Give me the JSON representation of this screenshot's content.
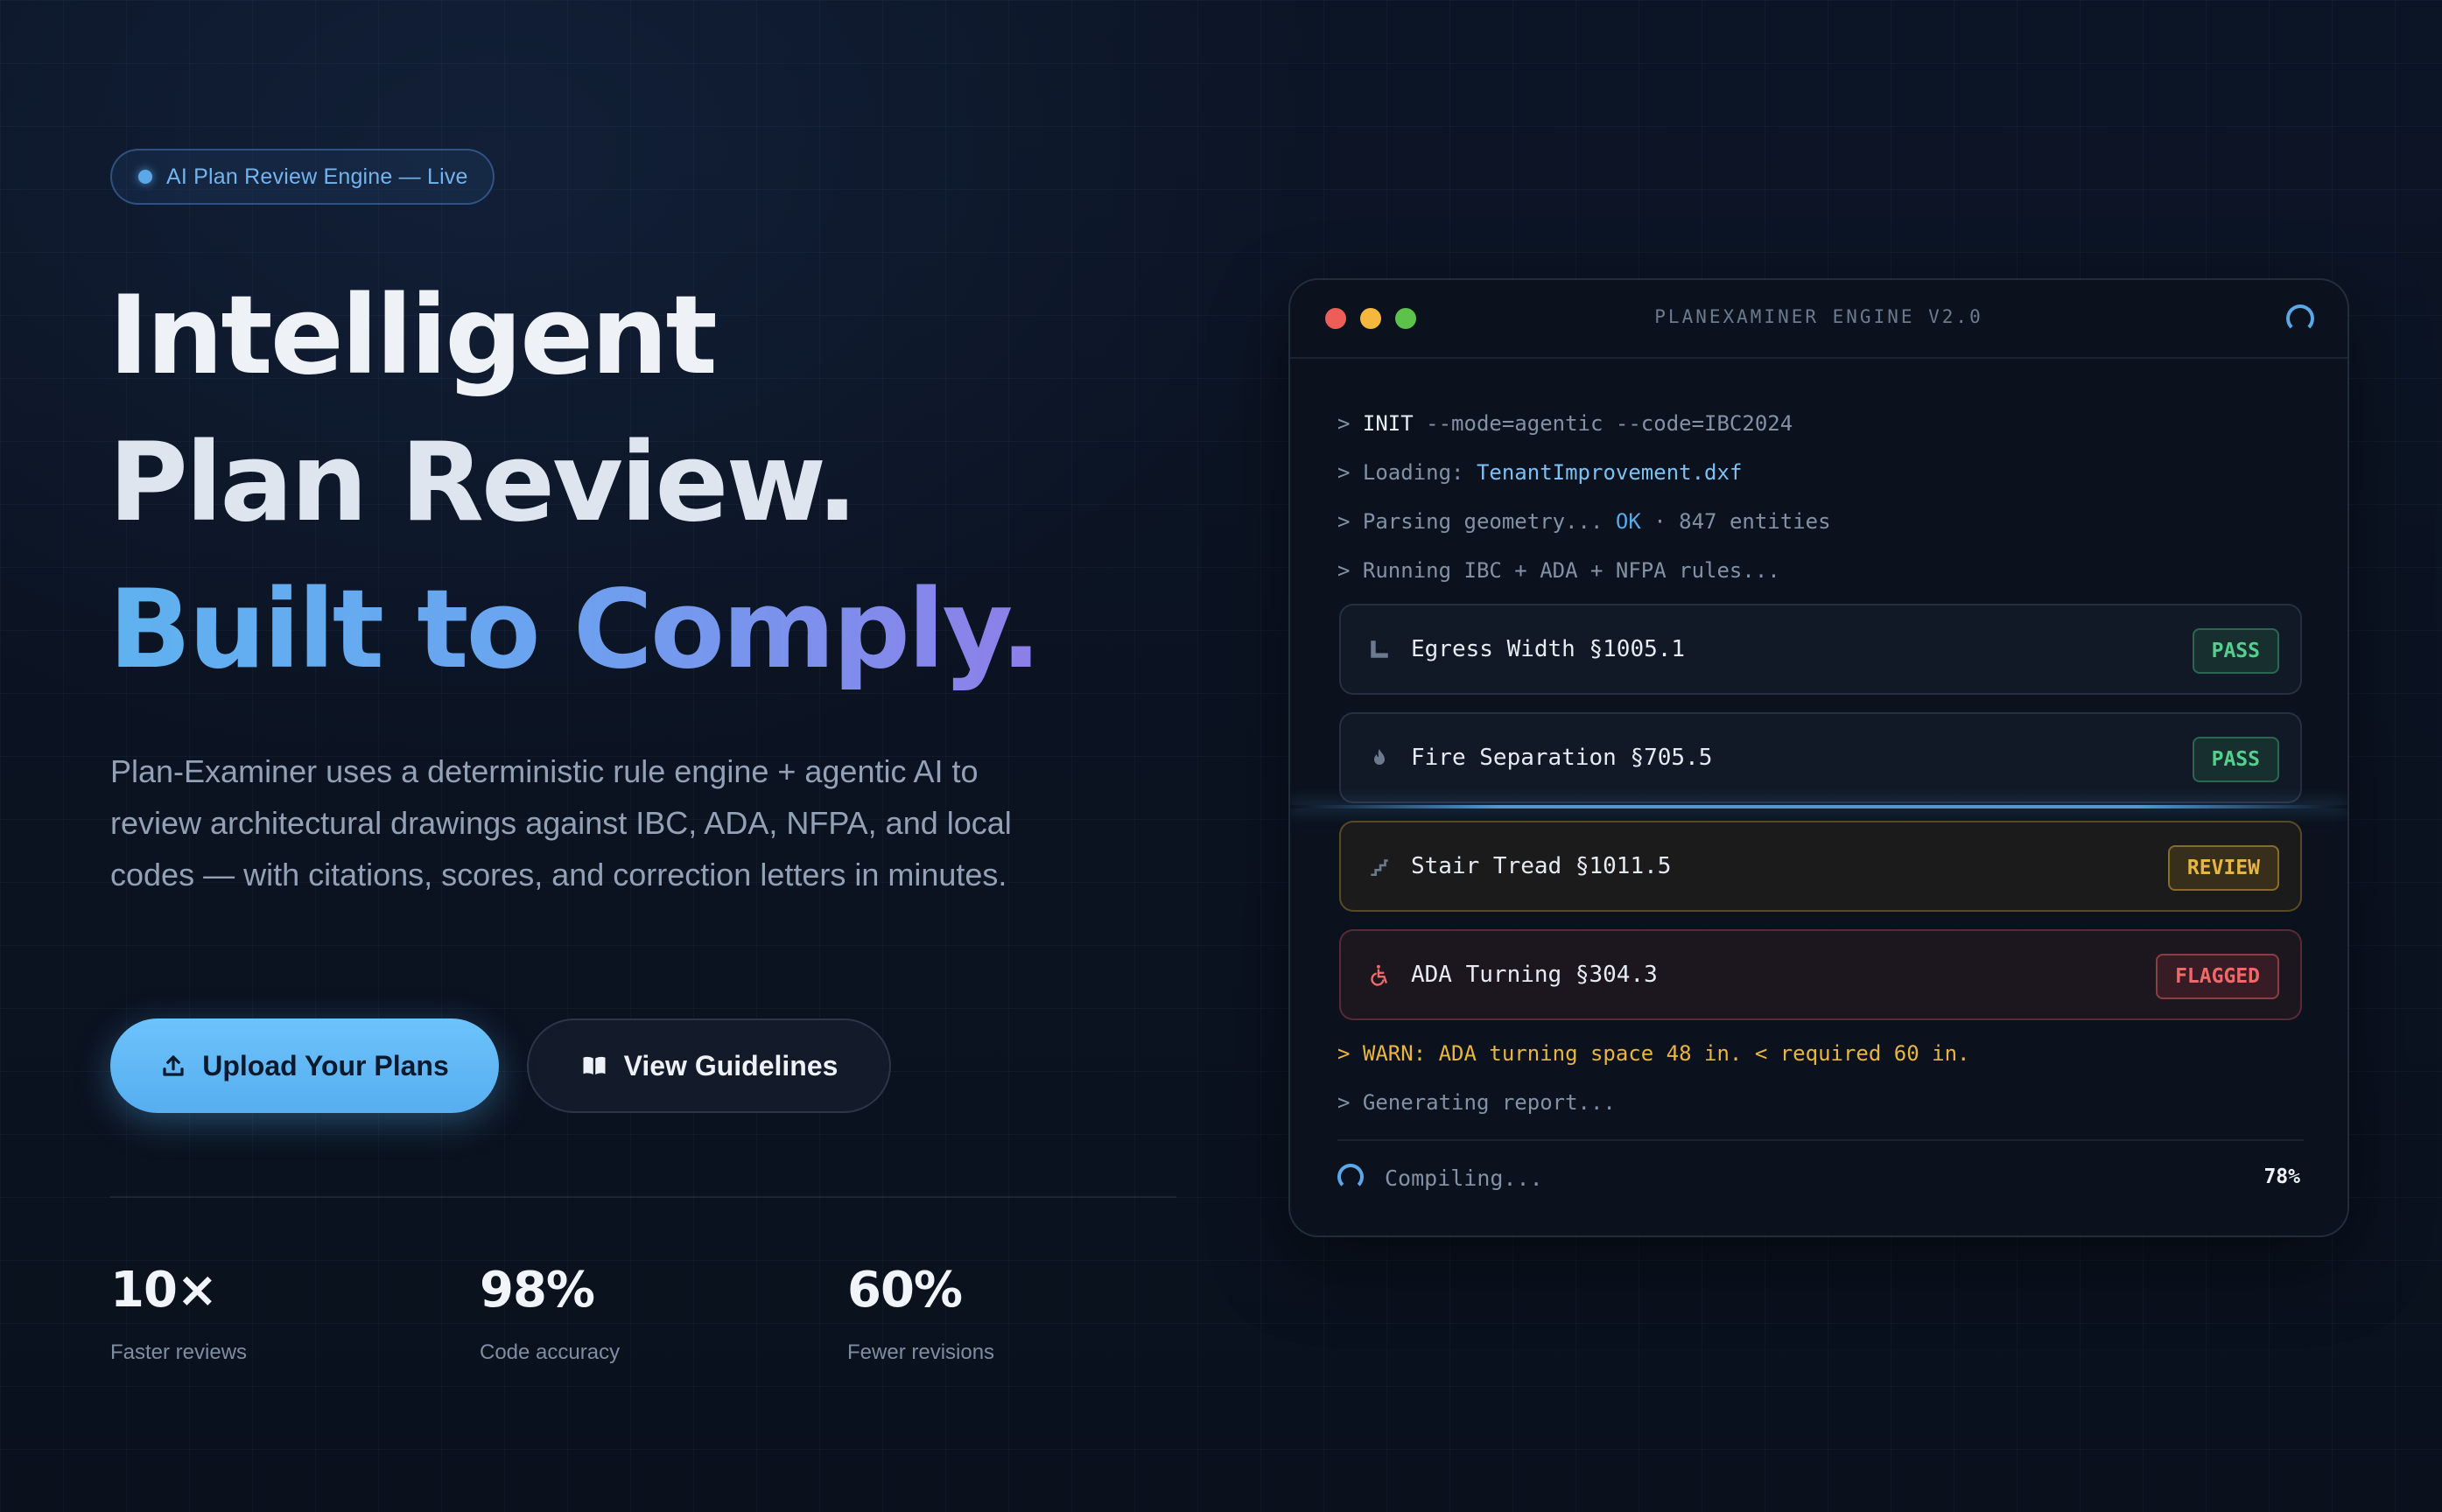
{
  "badge": {
    "text": "AI Plan Review Engine — Live"
  },
  "hero": {
    "line1": "Intelligent",
    "line2": "Plan Review.",
    "line3": "Built to Comply.",
    "description": "Plan-Examiner uses a deterministic rule engine + agentic AI to review architectural drawings against IBC, ADA, NFPA, and local codes — with citations, scores, and correction letters in minutes."
  },
  "buttons": {
    "primary": "Upload Your Plans",
    "secondary": "View Guidelines"
  },
  "stats": [
    {
      "value": "10×",
      "label": "Faster reviews"
    },
    {
      "value": "98%",
      "label": "Code accuracy"
    },
    {
      "value": "60%",
      "label": "Fewer revisions"
    }
  ],
  "terminal": {
    "title": "PLANEXAMINER ENGINE V2.0",
    "log": {
      "init_prompt": "> ",
      "init_cmd": "INIT",
      "init_args": " --mode=agentic --code=IBC2024",
      "loading_prefix": "> Loading: ",
      "loading_file": "TenantImprovement.dxf",
      "parsing_prefix": "> Parsing geometry... ",
      "parsing_ok": "OK",
      "parsing_suffix": " · 847 entities",
      "running": "> Running IBC + ADA + NFPA rules...",
      "warn": "> WARN: ADA turning space 48 in. < required 60 in.",
      "generating": "> Generating report..."
    },
    "checks": [
      {
        "label": "Egress Width §1005.1",
        "status": "PASS",
        "icon": "ruler-icon"
      },
      {
        "label": "Fire Separation §705.5",
        "status": "PASS",
        "icon": "flame-icon"
      },
      {
        "label": "Stair Tread §1011.5",
        "status": "REVIEW",
        "icon": "stairs-icon"
      },
      {
        "label": "ADA Turning §304.3",
        "status": "FLAGGED",
        "icon": "wheelchair-icon"
      }
    ],
    "footer": {
      "compiling": "Compiling...",
      "progress": "78%"
    }
  },
  "colors": {
    "accent": "#5aa8e8",
    "pass": "#54cf8f",
    "review": "#e8b542",
    "flagged": "#ee6a6a",
    "background": "#0b1220"
  }
}
